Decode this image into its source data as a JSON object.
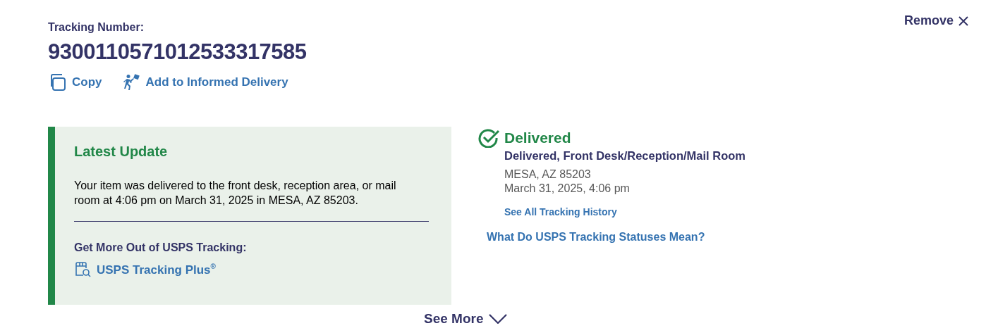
{
  "header": {
    "label": "Tracking Number:",
    "tracking_number": "9300110571012533317585",
    "remove": "Remove"
  },
  "actions": [
    {
      "kind": "copy",
      "label": "Copy"
    },
    {
      "kind": "informed",
      "label": "Add to Informed Delivery"
    }
  ],
  "latest_update": {
    "title": "Latest Update",
    "message": "Your item was delivered to the front desk, reception area, or mail room at 4:06 pm on March 31, 2025 in MESA, AZ 85203.",
    "promo_title": "Get More Out of USPS Tracking:",
    "promo_link": "USPS Tracking Plus$^{®}$"
  },
  "status": {
    "title": "Delivered",
    "detail": "Delivered, Front Desk/Reception/Mail Room",
    "location": "MESA, AZ 85203",
    "datetime": "March 31, 2025, 4:06 pm",
    "history_link": "See All Tracking History",
    "statuses_link": "What Do USPS Tracking Statuses Mean?"
  },
  "see_more": "See More"
}
